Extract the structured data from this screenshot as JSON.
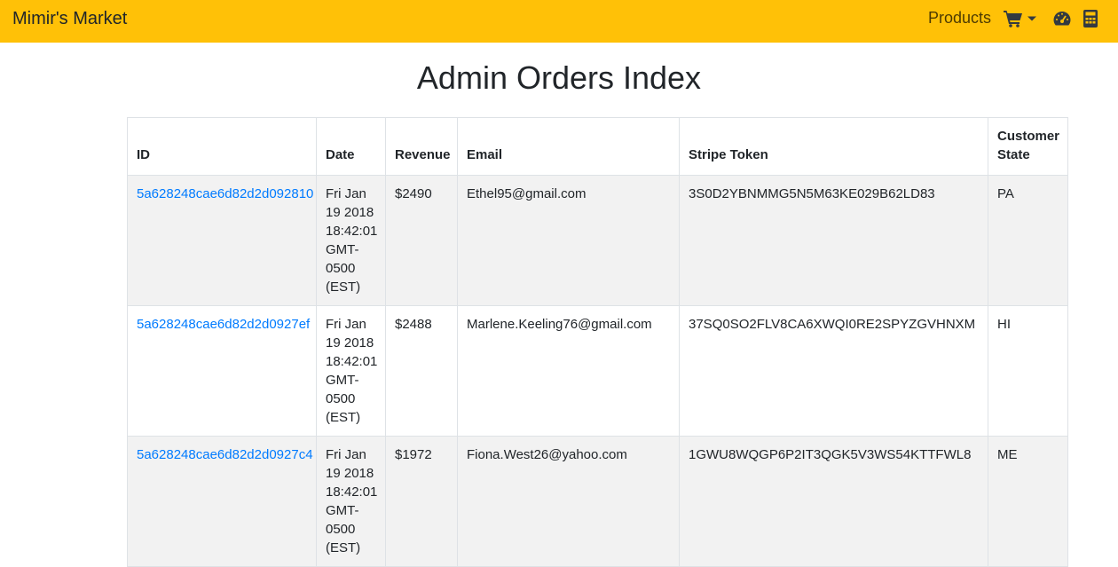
{
  "navbar": {
    "brand": "Mimir's Market",
    "products_label": "Products",
    "icons": {
      "cart": "shopping-cart-icon",
      "dropdown": "caret-down-icon",
      "dashboard": "tachometer-icon",
      "calculator": "calculator-icon"
    },
    "colors": {
      "background": "#ffc107"
    }
  },
  "page": {
    "title": "Admin Orders Index"
  },
  "table": {
    "headers": {
      "id": "ID",
      "date": "Date",
      "revenue": "Revenue",
      "email": "Email",
      "stripe_token": "Stripe Token",
      "customer_state": "Customer State"
    },
    "rows": [
      {
        "id": "5a628248cae6d82d2d092810",
        "date": "Fri Jan 19 2018 18:42:01 GMT-0500 (EST)",
        "revenue": "$2490",
        "email": "Ethel95@gmail.com",
        "stripe_token": "3S0D2YBNMMG5N5M63KE029B62LD83",
        "customer_state": "PA"
      },
      {
        "id": "5a628248cae6d82d2d0927ef",
        "date": "Fri Jan 19 2018 18:42:01 GMT-0500 (EST)",
        "revenue": "$2488",
        "email": "Marlene.Keeling76@gmail.com",
        "stripe_token": "37SQ0SO2FLV8CA6XWQI0RE2SPYZGVHNXM",
        "customer_state": "HI"
      },
      {
        "id": "5a628248cae6d82d2d0927c4",
        "date": "Fri Jan 19 2018 18:42:01 GMT-0500 (EST)",
        "revenue": "$1972",
        "email": "Fiona.West26@yahoo.com",
        "stripe_token": "1GWU8WQGP6P2IT3QGK5V3WS54KTTFWL8",
        "customer_state": "ME"
      }
    ]
  }
}
